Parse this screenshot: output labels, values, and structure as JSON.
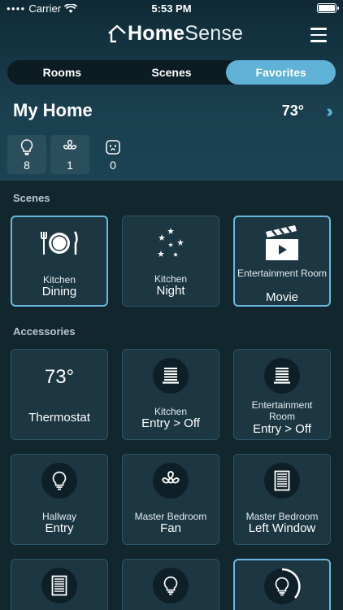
{
  "status_bar": {
    "carrier": "Carrier",
    "time": "5:53 PM"
  },
  "app": {
    "brand_part1": "Home",
    "brand_part2": "Sense"
  },
  "tabs": [
    {
      "label": "Rooms",
      "active": false
    },
    {
      "label": "Scenes",
      "active": false
    },
    {
      "label": "Favorites",
      "active": true
    }
  ],
  "home": {
    "title": "My Home",
    "temperature": "73°",
    "summary": [
      {
        "icon": "lightbulb-icon",
        "count": "8"
      },
      {
        "icon": "fan-icon",
        "count": "1"
      },
      {
        "icon": "outlet-icon",
        "count": "0"
      }
    ]
  },
  "scenes": {
    "label": "Scenes",
    "items": [
      {
        "room": "Kitchen",
        "name": "Dining",
        "icon": "dining-icon",
        "selected": true
      },
      {
        "room": "Kitchen",
        "name": "Night",
        "icon": "stars-icon",
        "selected": false
      },
      {
        "room": "Entertainment Room",
        "name": "Movie",
        "icon": "clapperboard-icon",
        "selected": true
      }
    ]
  },
  "accessories": {
    "label": "Accessories",
    "items": [
      {
        "value": "73°",
        "name": "Thermostat",
        "icon": "thermostat"
      },
      {
        "room": "Kitchen",
        "name": "Entry > Off",
        "icon": "blinds-icon"
      },
      {
        "room_line1": "Entertainment",
        "room_line2": "Room",
        "name": "Entry > Off",
        "icon": "blinds-icon"
      },
      {
        "room": "Hallway",
        "name": "Entry",
        "icon": "lightbulb-icon"
      },
      {
        "room": "Master Bedroom",
        "name": "Fan",
        "icon": "fan-icon"
      },
      {
        "room": "Master Bedroom",
        "name": "Left Window",
        "icon": "window-icon"
      }
    ]
  },
  "colors": {
    "accent": "#5fb1d6",
    "background": "#12262e",
    "tile": "#1c3642"
  }
}
